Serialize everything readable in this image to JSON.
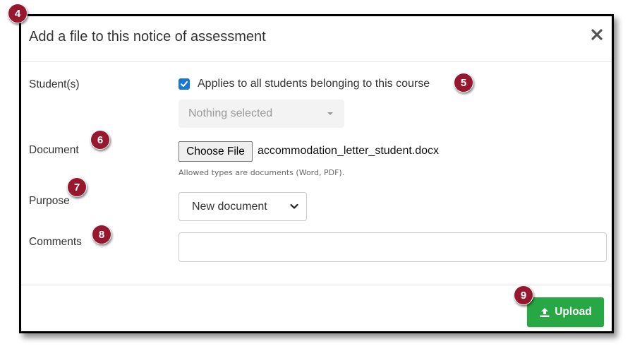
{
  "modal": {
    "title": "Add a file to this notice of assessment"
  },
  "form": {
    "students_label": "Student(s)",
    "applies_all_label": "Applies to all students belonging to this course",
    "applies_all_checked": true,
    "student_select_placeholder": "Nothing selected",
    "document_label": "Document",
    "choose_file_label": "Choose File",
    "file_name": "accommodation_letter_student.docx",
    "allowed_types_help": "Allowed types are documents (Word, PDF).",
    "purpose_label": "Purpose",
    "purpose_selected": "New document",
    "comments_label": "Comments",
    "comments_value": ""
  },
  "footer": {
    "upload_label": "Upload"
  },
  "callouts": [
    "4",
    "5",
    "6",
    "7",
    "8",
    "9"
  ],
  "colors": {
    "callout": "#97172e",
    "upload_button": "#28a745",
    "checkbox": "#1976d2"
  },
  "icons": {
    "close": "close-icon",
    "upload": "upload-icon",
    "checkbox": "check-icon",
    "select_caret": "caret-down-icon",
    "purpose_chevron": "chevron-down-icon"
  }
}
